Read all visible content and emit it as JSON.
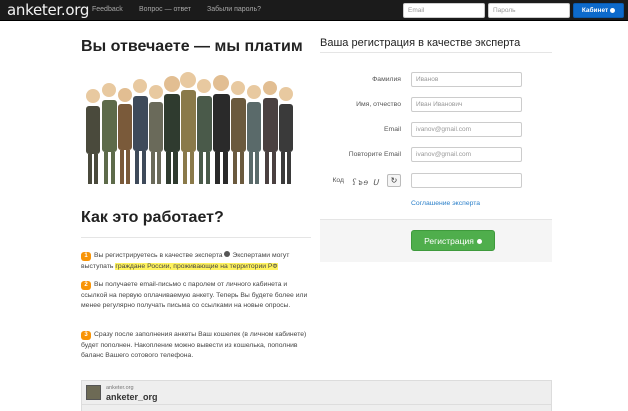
{
  "navbar": {
    "brand": "anketer.org",
    "links": [
      "Feedback",
      "Вопрос — ответ",
      "Забыли пароль?"
    ],
    "email_placeholder": "Email",
    "password_placeholder": "Пароль",
    "cabinet_label": "Кабинет"
  },
  "left": {
    "heading": "Вы отвечаете — мы платим",
    "how_heading": "Как это работает?",
    "steps": [
      {
        "num": "1",
        "text_a": "Вы регистрируетесь в качестве эксперта ",
        "text_b": " Экспертами могут выступать ",
        "highlight": "граждане России, проживающие на территории РФ"
      },
      {
        "num": "2",
        "text": "Вы получаете email-письмо с паролем от личного кабинета и ссылкой на первую оплачиваемую анкету. Теперь Вы будете более или менее регулярно получать письма со ссылками на новые опросы."
      },
      {
        "num": "3",
        "text": "Сразу после заполнения анкеты Ваш кошелек (в личном кабинете) будет пополнен. Накопление можно вывести из кошелька, пополнив баланс Вашего сотового телефона."
      }
    ]
  },
  "registration": {
    "title": "Ваша регистрация в качестве эксперта",
    "fields": [
      {
        "label": "Фамилия",
        "placeholder": "Иванов"
      },
      {
        "label": "Имя, отчество",
        "placeholder": "Иван Иванович"
      },
      {
        "label": "Email",
        "placeholder": "ivanov@gmail.com"
      },
      {
        "label": "Повторите Email",
        "placeholder": "ivanov@gmail.com"
      }
    ],
    "code_label": "Код",
    "captcha_text": "ʕ๖ɘ ᑌ",
    "agreement_link": "Соглашение эксперта",
    "submit_label": "Регистрация"
  },
  "card": {
    "sub": "anketer.org",
    "name": "anketer_org"
  },
  "colors": {
    "navbar": "#1b1b1b",
    "primary": "#0d6acb",
    "success": "#4fae4c",
    "badge": "#f89406",
    "highlight": "#fff35d",
    "link": "#2a7fc9"
  }
}
